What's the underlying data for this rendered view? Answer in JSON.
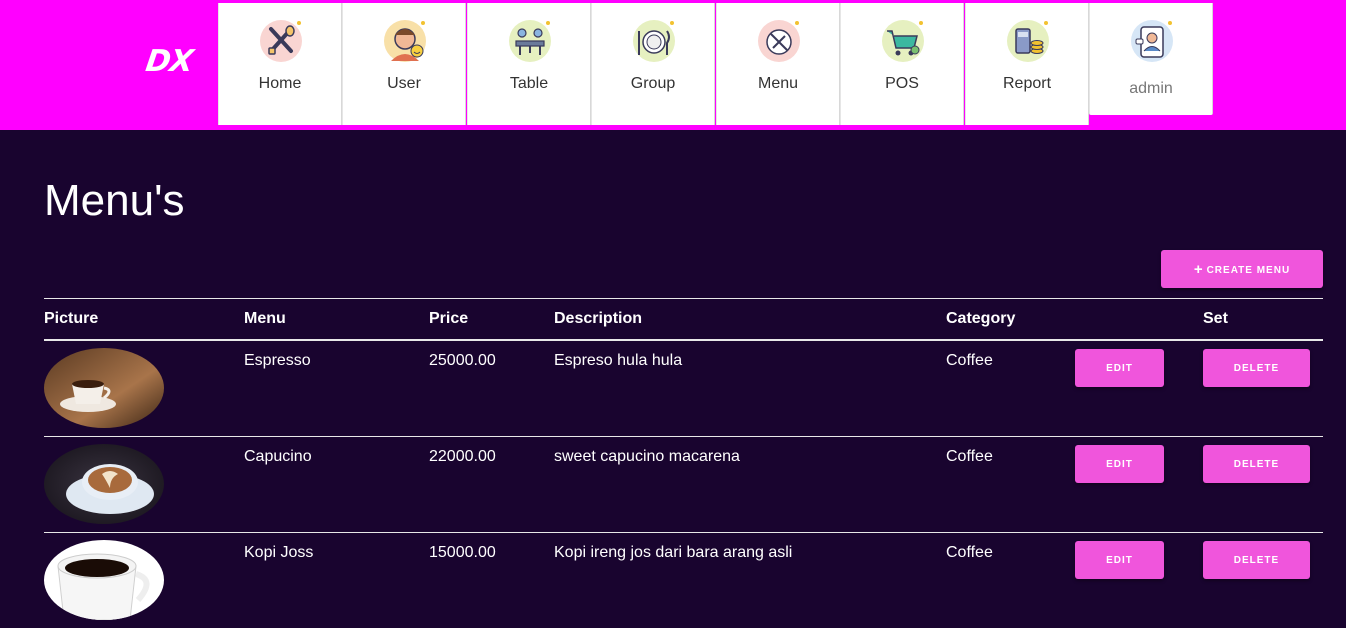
{
  "app": {
    "logo_text": "DX"
  },
  "nav": {
    "items": [
      {
        "label": "Home",
        "icon": "fork-spoon-icon"
      },
      {
        "label": "User",
        "icon": "user-avatar-icon"
      },
      {
        "label": "Table",
        "icon": "dining-table-icon"
      },
      {
        "label": "Group",
        "icon": "plate-cutlery-icon"
      },
      {
        "label": "Menu",
        "icon": "menu-plate-icon"
      },
      {
        "label": "POS",
        "icon": "shopping-cart-icon"
      },
      {
        "label": "Report",
        "icon": "calculator-coins-icon"
      },
      {
        "label": "admin",
        "icon": "admin-profile-icon"
      }
    ]
  },
  "page": {
    "title": "Menu's",
    "create_button": "CREATE MENU"
  },
  "table": {
    "headers": {
      "picture": "Picture",
      "menu": "Menu",
      "price": "Price",
      "description": "Description",
      "category": "Category",
      "set": "Set"
    },
    "rows": [
      {
        "menu": "Espresso",
        "price": "25000.00",
        "description": "Espreso hula hula",
        "category": "Coffee",
        "edit": "EDIT",
        "delete": "DELETE"
      },
      {
        "menu": "Capucino",
        "price": "22000.00",
        "description": "sweet capucino macarena",
        "category": "Coffee",
        "edit": "EDIT",
        "delete": "DELETE"
      },
      {
        "menu": "Kopi Joss",
        "price": "15000.00",
        "description": "Kopi ireng jos dari bara arang asli",
        "category": "Coffee",
        "edit": "EDIT",
        "delete": "DELETE"
      }
    ]
  },
  "colors": {
    "header_bg": "#ff00ff",
    "page_bg": "#19042f",
    "accent": "#f055dc"
  }
}
